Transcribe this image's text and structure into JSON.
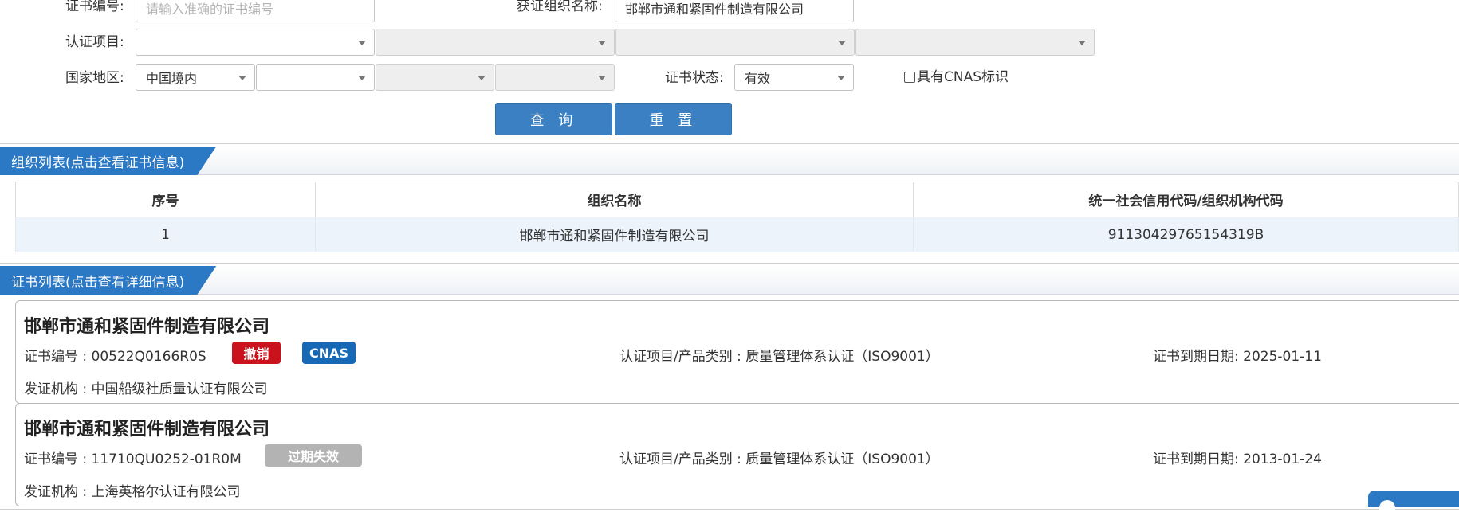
{
  "search": {
    "cert_no_label": "证书编号:",
    "cert_no_placeholder": "请输入准确的证书编号",
    "org_name_label": "获证组织名称:",
    "org_name_value": "邯郸市通和紧固件制造有限公司",
    "cert_item_label": "认证项目:",
    "cert_item_values": [
      "",
      "",
      "",
      ""
    ],
    "region_label": "国家地区:",
    "region_values": [
      "中国境内",
      "",
      "",
      ""
    ],
    "status_label": "证书状态:",
    "status_value": "有效",
    "cnas_checkbox_label": "具有CNAS标识",
    "cnas_checked": false,
    "query_button": "查 询",
    "reset_button": "重 置"
  },
  "org_list": {
    "title": "组织列表(点击查看证书信息)",
    "columns": [
      "序号",
      "组织名称",
      "统一社会信用代码/组织机构代码"
    ],
    "rows": [
      [
        "1",
        "邯郸市通和紧固件制造有限公司",
        "91130429765154319B"
      ]
    ]
  },
  "cert_list": {
    "title": "证书列表(点击查看详细信息)",
    "items": [
      {
        "org_name": "邯郸市通和紧固件制造有限公司",
        "cert_no": "证书编号 : 00522Q0166R0S",
        "status_badge": "撤销",
        "cnas_badge": "CNAS",
        "category": "认证项目/产品类别 : 质量管理体系认证（ISO9001）",
        "expiry": "证书到期日期: 2025-01-11",
        "issuer": "发证机构 : 中国船级社质量认证有限公司"
      },
      {
        "org_name": "邯郸市通和紧固件制造有限公司",
        "cert_no": "证书编号 : 11710QU0252-01R0M",
        "status_badge": "过期失效",
        "category": "认证项目/产品类别 : 质量管理体系认证（ISO9001）",
        "expiry": "证书到期日期: 2013-01-24",
        "issuer": "发证机构 : 上海英格尔认证有限公司"
      }
    ]
  },
  "colors": {
    "primary_blue": "#2b78c4",
    "button_blue": "#3a80c3",
    "revoked_red": "#c9121b",
    "cnas_blue": "#1769b6",
    "expired_gray": "#b3b3b3"
  }
}
